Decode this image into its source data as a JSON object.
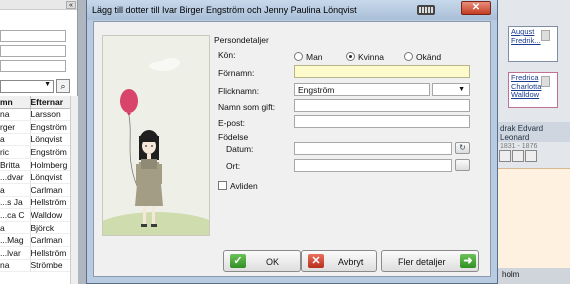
{
  "dialog": {
    "title": "Lägg till dotter till Ivar Birger Engström och Jenny Paulina Lönqvist",
    "close_symbol": "✕",
    "section": "Persondetaljer",
    "gender": {
      "label": "Kön:",
      "options": [
        "Man",
        "Kvinna",
        "Okänd"
      ],
      "selected": "Kvinna"
    },
    "first_name": {
      "label": "Förnamn:",
      "value": ""
    },
    "maiden_name": {
      "label": "Flicknamn:",
      "value": "Engström"
    },
    "married_name": {
      "label": "Namn som gift:",
      "value": ""
    },
    "email": {
      "label": "E-post:",
      "value": ""
    },
    "birth": {
      "label": "Födelse",
      "date_label": "Datum:",
      "date_value": "",
      "place_label": "Ort:",
      "place_value": ""
    },
    "deceased": {
      "label": "Avliden",
      "checked": false
    },
    "buttons": {
      "ok": "OK",
      "cancel": "Avbryt",
      "more": "Fler detaljer"
    },
    "icons": {
      "ok": "check-icon",
      "cancel": "x-icon",
      "more": "arrow-right-icon",
      "keyboard": "keyboard-icon"
    }
  },
  "background": {
    "collapse_symbol": "«",
    "table": {
      "headers": [
        "mn",
        "Efternar"
      ],
      "rows": [
        [
          "na",
          "Larsson"
        ],
        [
          "rger",
          "Engström"
        ],
        [
          "a",
          "Lönqvist"
        ],
        [
          "ric",
          "Engström"
        ],
        [
          "Britta",
          "Holmberg"
        ],
        [
          "dvar...",
          "Lönqvist"
        ],
        [
          "a",
          "Carlman"
        ],
        [
          "s Ja...",
          "Hellström"
        ],
        [
          "ca C...",
          "Walldow"
        ],
        [
          "a",
          "Björck"
        ],
        [
          "Mag...",
          "Carlman"
        ],
        [
          "lvar...",
          "Hellström"
        ],
        [
          "na",
          "Strömbe"
        ]
      ]
    },
    "person_cards": [
      {
        "name": "August Fredrik...",
        "dates": ""
      },
      {
        "name": "Fredrica Charlotta Walldow",
        "dates": ""
      }
    ],
    "selected_person": {
      "name": "drak Edvard Leonard",
      "dates": "1831 - 1876"
    },
    "bottom_text": "holm"
  }
}
